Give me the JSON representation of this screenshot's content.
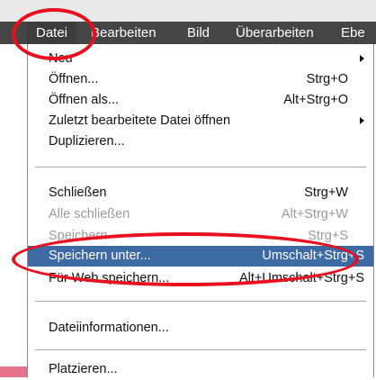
{
  "menubar": {
    "items": [
      "Datei",
      "Bearbeiten",
      "Bild",
      "Überarbeiten",
      "Ebe"
    ]
  },
  "menu": {
    "items": [
      {
        "label": "Neu",
        "shortcut": "",
        "submenu": true,
        "disabled": false,
        "highlighted": false
      },
      {
        "label": "Öffnen...",
        "shortcut": "Strg+O",
        "submenu": false,
        "disabled": false,
        "highlighted": false
      },
      {
        "label": "Öffnen als...",
        "shortcut": "Alt+Strg+O",
        "submenu": false,
        "disabled": false,
        "highlighted": false
      },
      {
        "label": "Zuletzt bearbeitete Datei öffnen",
        "shortcut": "",
        "submenu": true,
        "disabled": false,
        "highlighted": false
      },
      {
        "label": "Duplizieren...",
        "shortcut": "",
        "submenu": false,
        "disabled": false,
        "highlighted": false
      },
      {
        "label": "Schließen",
        "shortcut": "Strg+W",
        "submenu": false,
        "disabled": false,
        "highlighted": false
      },
      {
        "label": "Alle schließen",
        "shortcut": "Alt+Strg+W",
        "submenu": false,
        "disabled": true,
        "highlighted": false
      },
      {
        "label": "Speichern",
        "shortcut": "Strg+S",
        "submenu": false,
        "disabled": true,
        "highlighted": false
      },
      {
        "label": "Speichern unter...",
        "shortcut": "Umschalt+Strg+S",
        "submenu": false,
        "disabled": false,
        "highlighted": true
      },
      {
        "label": "Für Web speichern...",
        "shortcut": "Alt+Umschalt+Strg+S",
        "submenu": false,
        "disabled": false,
        "highlighted": false
      },
      {
        "label": "Dateiinformationen...",
        "shortcut": "",
        "submenu": false,
        "disabled": false,
        "highlighted": false
      },
      {
        "label": "Platzieren...",
        "shortcut": "",
        "submenu": false,
        "disabled": false,
        "highlighted": false
      }
    ]
  },
  "colors": {
    "menubar": "#454545",
    "highlight": "#3d6aa3",
    "annotation": "#e8101e"
  }
}
